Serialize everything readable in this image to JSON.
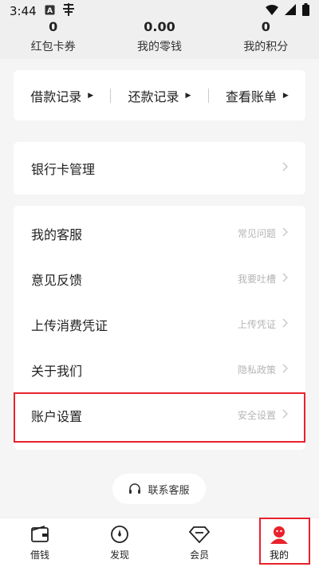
{
  "status": {
    "time": "3:44",
    "icons": [
      "a-box-icon",
      "app-icon"
    ],
    "right_icons": [
      "wifi-icon",
      "signal-icon",
      "battery-icon"
    ]
  },
  "stats": [
    {
      "value": "0",
      "label": "红包卡券"
    },
    {
      "value": "0.00",
      "label": "我的零钱"
    },
    {
      "value": "0",
      "label": "我的积分"
    }
  ],
  "records": [
    {
      "label": "借款记录"
    },
    {
      "label": "还款记录"
    },
    {
      "label": "查看账单"
    }
  ],
  "bank": {
    "label": "银行卡管理"
  },
  "menu": [
    {
      "label": "我的客服",
      "hint": "常见问题"
    },
    {
      "label": "意见反馈",
      "hint": "我要吐槽"
    },
    {
      "label": "上传消费凭证",
      "hint": "上传凭证"
    },
    {
      "label": "关于我们",
      "hint": "隐私政策"
    },
    {
      "label": "账户设置",
      "hint": "安全设置"
    }
  ],
  "contact": {
    "label": "联系客服"
  },
  "tabs": [
    {
      "label": "借钱",
      "icon": "wallet-icon"
    },
    {
      "label": "发现",
      "icon": "compass-icon"
    },
    {
      "label": "会员",
      "icon": "diamond-icon"
    },
    {
      "label": "我的",
      "icon": "user-icon"
    }
  ],
  "colors": {
    "accent": "#e8222c",
    "background": "#f5f5f5"
  }
}
